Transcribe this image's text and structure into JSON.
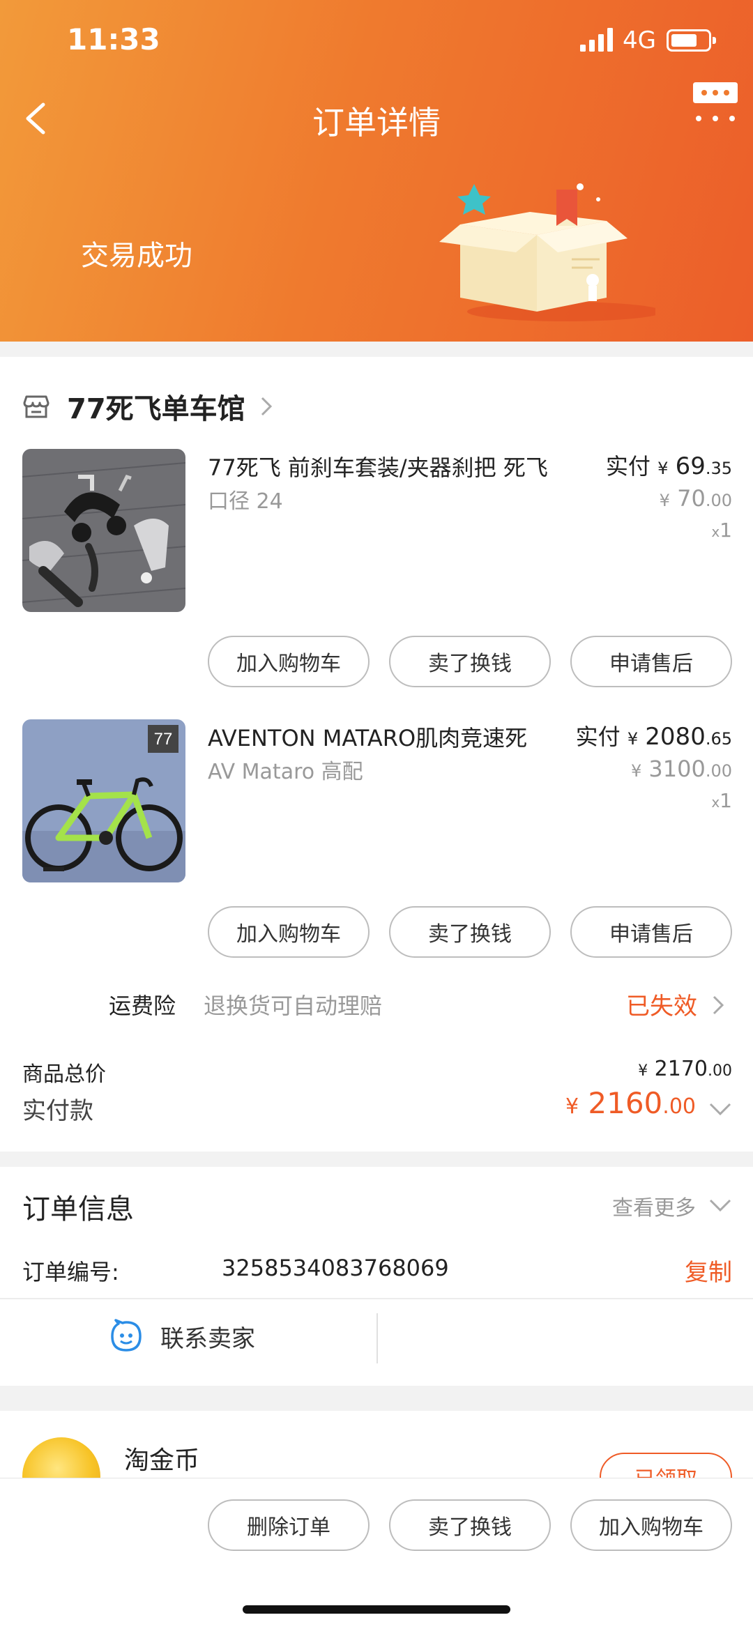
{
  "status_bar": {
    "time": "11:33",
    "network": "4G"
  },
  "header": {
    "title": "订单详情",
    "deal_status": "交易成功"
  },
  "shop": {
    "name": "77死飞单车馆"
  },
  "items": [
    {
      "title": "77死飞 前刹车套装/夹器刹把 死飞",
      "spec": "口径 24",
      "paid_label": "实付",
      "paid_currency": "¥",
      "paid_int": "69",
      "paid_dec": ".35",
      "orig_currency": "¥",
      "orig_int": "70",
      "orig_dec": ".00",
      "qty_x": "x",
      "qty": "1",
      "actions": [
        "加入购物车",
        "卖了换钱",
        "申请售后"
      ]
    },
    {
      "title": "AVENTON MATARO肌肉竞速死",
      "spec": "AV Mataro 高配",
      "paid_label": "实付",
      "paid_currency": "¥",
      "paid_int": "2080",
      "paid_dec": ".65",
      "orig_currency": "¥",
      "orig_int": "3100",
      "orig_dec": ".00",
      "qty_x": "x",
      "qty": "1",
      "thumb_badge": "77",
      "actions": [
        "加入购物车",
        "卖了换钱",
        "申请售后"
      ]
    }
  ],
  "insurance": {
    "label": "运费险",
    "desc": "退换货可自动理赔",
    "status": "已失效"
  },
  "summary": {
    "total_label": "商品总价",
    "total_currency": "¥",
    "total_int": "2170",
    "total_dec": ".00",
    "paid_label": "实付款",
    "paid_currency": "¥",
    "paid_int": "2160",
    "paid_dec": ".00"
  },
  "order_info": {
    "title": "订单信息",
    "more": "查看更多",
    "order_no_label": "订单编号:",
    "order_no": "3258534083768069",
    "copy": "复制",
    "contact": "联系卖家"
  },
  "coins": {
    "title": "淘金币",
    "button": "已领取"
  },
  "bottom_actions": [
    "删除订单",
    "卖了换钱",
    "加入购物车"
  ],
  "colors": {
    "accent": "#ef5b26",
    "header_start": "#f29a3a",
    "header_end": "#ec5e2a"
  }
}
